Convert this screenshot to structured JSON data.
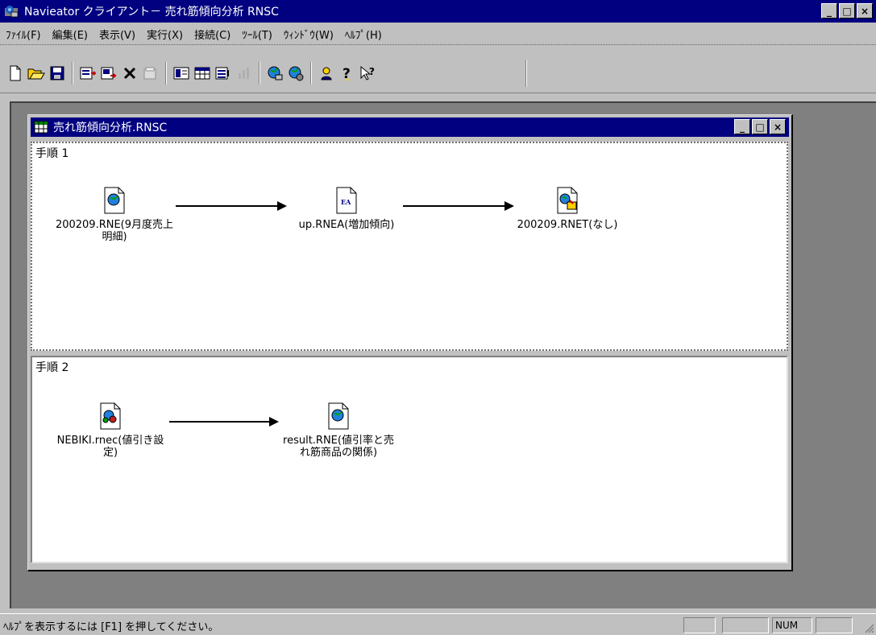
{
  "app": {
    "title": "Navieator クライアント－ 売れ筋傾向分析 RNSC",
    "controls": {
      "minimize": "_",
      "maximize": "□",
      "close": "×"
    }
  },
  "menu": [
    "ﾌｧｲﾙ(F)",
    "編集(E)",
    "表示(V)",
    "実行(X)",
    "接続(C)",
    "ﾂｰﾙ(T)",
    "ｳｨﾝﾄﾞｳ(W)",
    "ﾍﾙﾌﾟ(H)"
  ],
  "toolbar": {
    "icons": [
      "new-icon",
      "open-folder-icon",
      "save-icon",
      "import-icon",
      "export-icon",
      "delete-icon",
      "properties-icon",
      "layout-icon",
      "table-icon",
      "columns-icon",
      "chart-icon",
      "network-icon",
      "network-settings-icon",
      "user-icon",
      "help-icon",
      "context-help-icon"
    ]
  },
  "child_window": {
    "title": "売れ筋傾向分析.RNSC"
  },
  "steps": [
    {
      "label": "手順 1",
      "nodes": [
        {
          "caption": "200209.RNE(9月度売上\n明細)",
          "icon": "globe-file-icon"
        },
        {
          "caption": "up.RNEA(増加傾向)",
          "icon": "ea-file-icon",
          "badge": "EA"
        },
        {
          "caption": "200209.RNET(なし)",
          "icon": "globe-export-file-icon"
        }
      ]
    },
    {
      "label": "手順 2",
      "nodes": [
        {
          "caption": "NEBIKI.rnec(値引き設\n定)",
          "icon": "settings-file-icon"
        },
        {
          "caption": "result.RNE(値引率と売\nれ筋商品の関係)",
          "icon": "globe-file-icon"
        }
      ]
    }
  ],
  "status": {
    "text": "ﾍﾙﾌﾟを表示するには [F1] を押してください。",
    "num": "NUM"
  },
  "colors": {
    "titlebar": "#000080",
    "face": "#c0c0c0",
    "workspace": "#808080"
  }
}
